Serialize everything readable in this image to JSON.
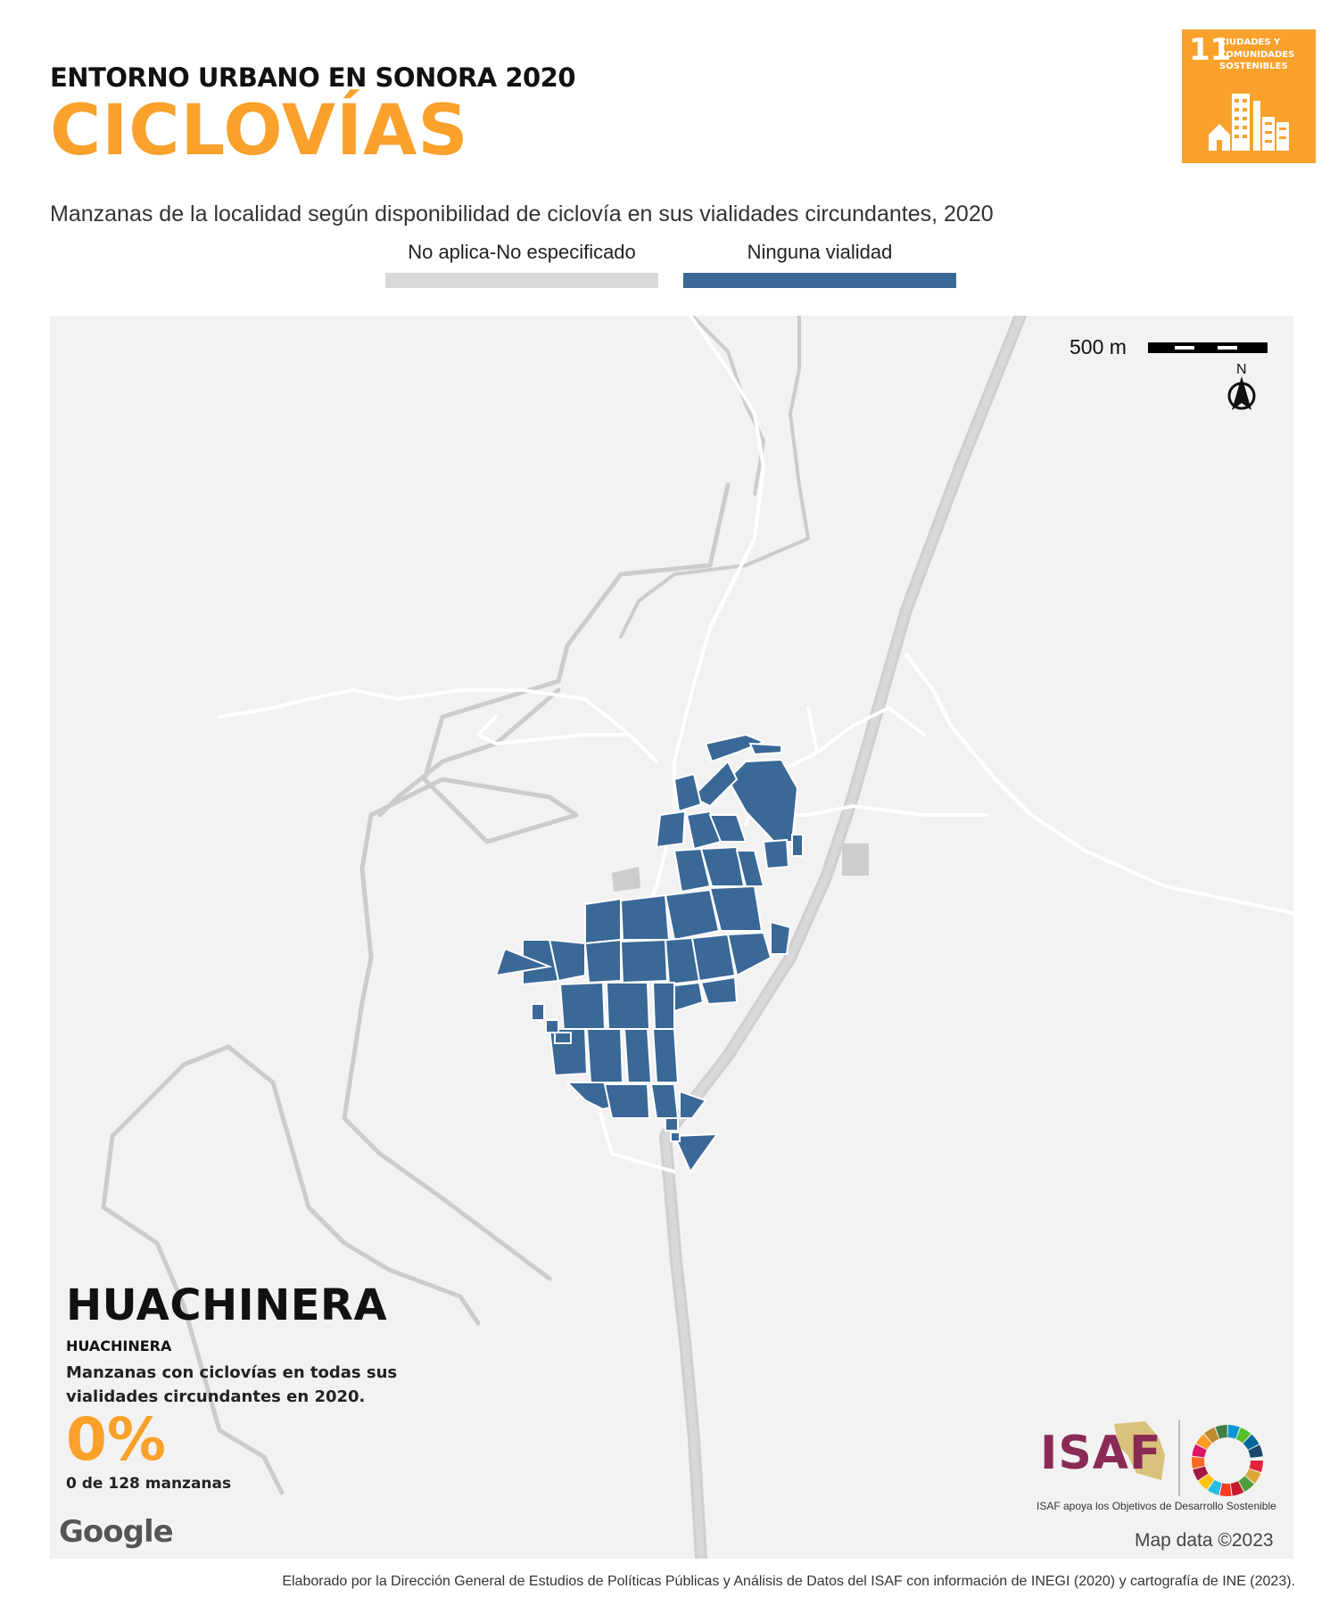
{
  "header": {
    "pre_title": "ENTORNO URBANO EN SONORA 2020",
    "title": "CICLOVÍAS",
    "subtitle": "Manzanas de la localidad según disponibilidad de ciclovía en sus vialidades circundantes, 2020"
  },
  "sdg_badge": {
    "number": "11",
    "label": "CIUDADES Y COMUNIDADES SOSTENIBLES",
    "color": "#f9a12b",
    "icon": "city-buildings-icon"
  },
  "legend": [
    {
      "label": "No aplica-No especificado",
      "color": "#d9d9d9"
    },
    {
      "label": "Ninguna vialidad",
      "color": "#3a6897"
    }
  ],
  "map": {
    "scale_label": "500 m",
    "north_label": "N",
    "blocks_color": "#3a6897",
    "other_color": "#cdcdcd",
    "background": "#f2f2f2"
  },
  "locality": {
    "name": "HUACHINERA",
    "municipality": "HUACHINERA",
    "description": "Manzanas con ciclovías en todas sus vialidades circundantes en 2020.",
    "percent": "0%",
    "count": "0 de 128 manzanas"
  },
  "attribution": {
    "google": "Google",
    "map_data": "Map data ©2023",
    "isaf": "ISAF",
    "isaf_tagline": "ISAF apoya los Objetivos de Desarrollo Sostenible",
    "credit": "Elaborado por la Dirección General de Estudios de Políticas Públicas y Análisis de Datos del ISAF con información de INEGI (2020) y cartografía de INE (2023)."
  }
}
